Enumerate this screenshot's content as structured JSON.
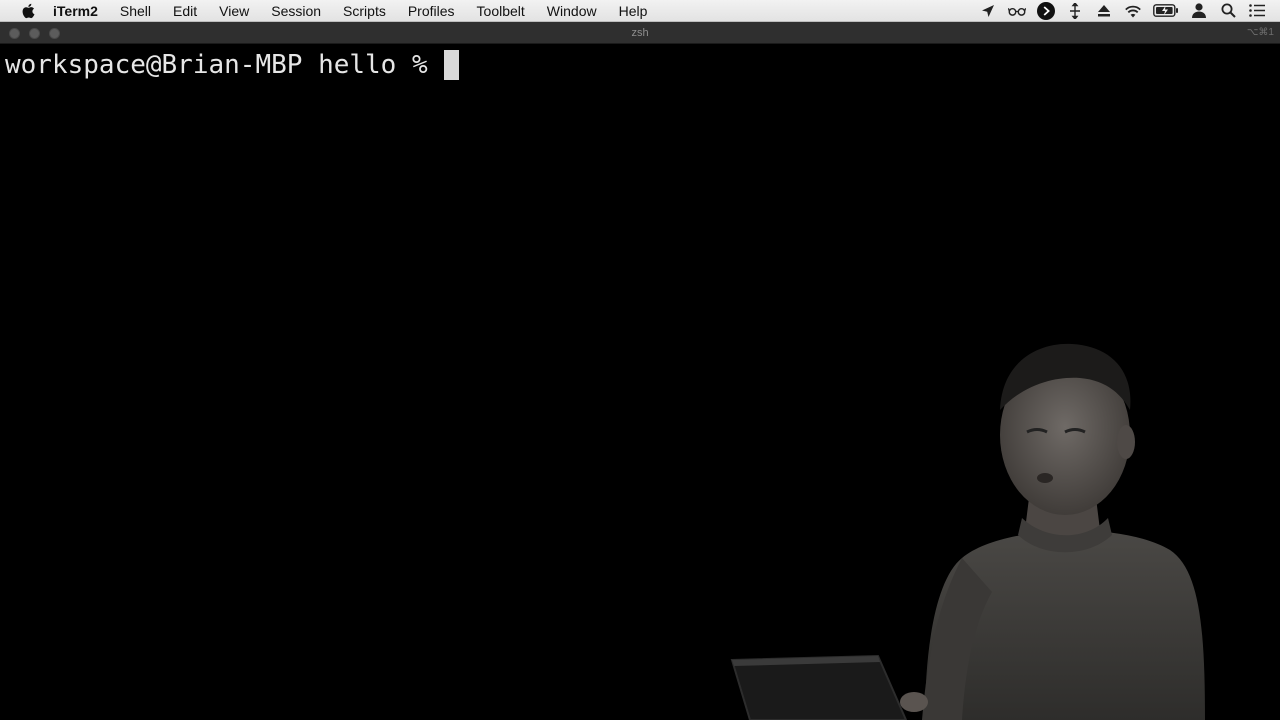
{
  "menubar": {
    "apple_icon": "apple-logo-icon",
    "app_name": "iTerm2",
    "items": [
      {
        "label": "Shell"
      },
      {
        "label": "Edit"
      },
      {
        "label": "View"
      },
      {
        "label": "Session"
      },
      {
        "label": "Scripts"
      },
      {
        "label": "Profiles"
      },
      {
        "label": "Toolbelt"
      },
      {
        "label": "Window"
      },
      {
        "label": "Help"
      }
    ],
    "status_icons": [
      "location-arrow-icon",
      "glasses-icon",
      "play-circle-icon",
      "move-arrows-icon",
      "eject-icon",
      "wifi-icon",
      "battery-charging-icon",
      "user-icon",
      "spotlight-search-icon",
      "notification-center-icon"
    ]
  },
  "window": {
    "title": "zsh",
    "shortcut": "⌥⌘1"
  },
  "terminal": {
    "prompt": "workspace@Brian-MBP hello %",
    "foreground_color": "#e6e6e6",
    "background_color": "#000000"
  }
}
